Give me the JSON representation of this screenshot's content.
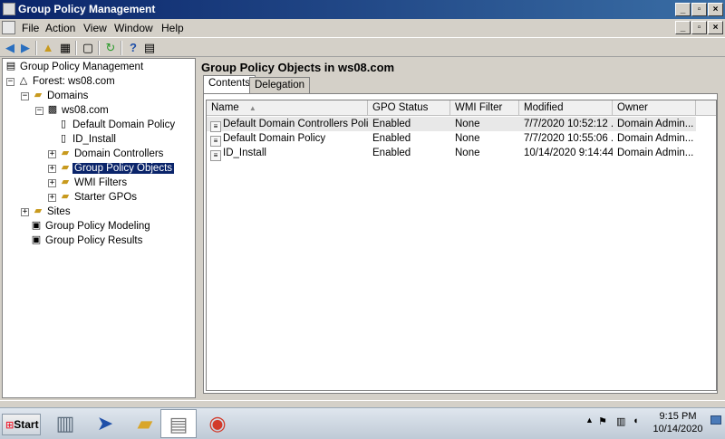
{
  "window": {
    "title": "Group Policy Management"
  },
  "menu": {
    "items": [
      "File",
      "Action",
      "View",
      "Window",
      "Help"
    ]
  },
  "toolbar": {
    "icons": [
      "back-arrow-icon",
      "forward-arrow-icon",
      "up-folder-icon",
      "show-hide-tree-icon",
      "new-window-icon",
      "refresh-icon",
      "help-icon",
      "properties-icon"
    ]
  },
  "tree": {
    "root": "Group Policy Management",
    "forest": "Forest: ws08.com",
    "domains": "Domains",
    "domain": "ws08.com",
    "default_domain_policy": "Default Domain Policy",
    "id_install": "ID_Install",
    "domain_controllers": "Domain Controllers",
    "group_policy_objects": "Group Policy Objects",
    "wmi_filters": "WMI Filters",
    "starter_gpos": "Starter GPOs",
    "sites": "Sites",
    "modeling": "Group Policy Modeling",
    "results": "Group Policy Results"
  },
  "content": {
    "heading": "Group Policy Objects in ws08.com",
    "tabs": [
      "Contents",
      "Delegation"
    ],
    "columns": [
      "Name",
      "GPO Status",
      "WMI Filter",
      "Modified",
      "Owner"
    ],
    "rows": [
      [
        "Default Domain Controllers Policy",
        "Enabled",
        "None",
        "7/7/2020 10:52:12 ...",
        "Domain Admin..."
      ],
      [
        "Default Domain Policy",
        "Enabled",
        "None",
        "7/7/2020 10:55:06 ...",
        "Domain Admin..."
      ],
      [
        "ID_Install",
        "Enabled",
        "None",
        "10/14/2020 9:14:44...",
        "Domain Admin..."
      ]
    ]
  },
  "taskbar": {
    "start_label": "Start",
    "time": "9:15 PM",
    "date": "10/14/2020",
    "apps": [
      "server-manager-icon",
      "powershell-icon",
      "explorer-folder-icon",
      "group-policy-icon",
      "chrome-icon"
    ]
  },
  "colors": {
    "titlebar": "#0a246a",
    "selection": "#0a246a",
    "window_bg": "#d4d0c8"
  }
}
